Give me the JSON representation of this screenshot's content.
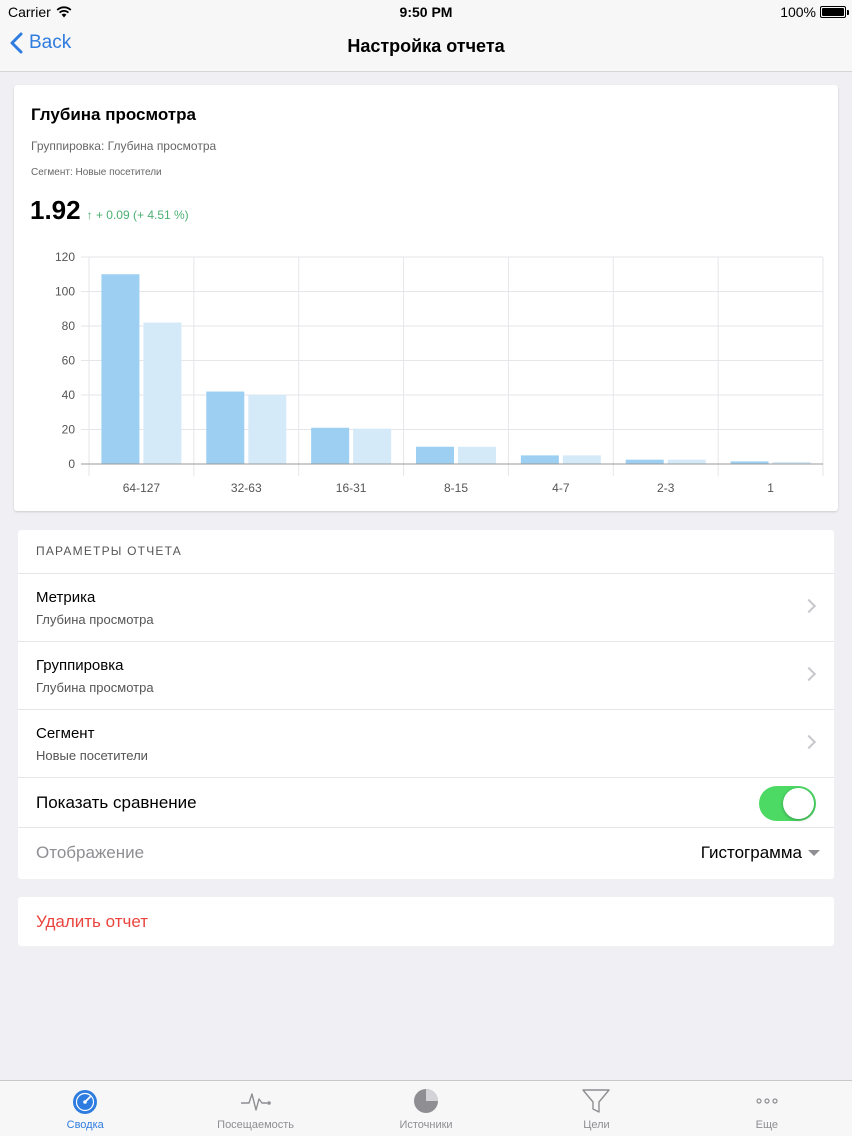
{
  "status_bar": {
    "carrier": "Carrier",
    "time": "9:50 PM",
    "battery": "100%"
  },
  "nav": {
    "back_label": "Back",
    "title": "Настройка отчета"
  },
  "report": {
    "title": "Глубина просмотра",
    "grouping": "Группировка: Глубина просмотра",
    "segment": "Сегмент: Новые посетители",
    "value": "1.92",
    "delta": "↑ + 0.09 (+ 4.51 %)"
  },
  "chart_data": {
    "type": "bar",
    "categories": [
      "64-127",
      "32-63",
      "16-31",
      "8-15",
      "4-7",
      "2-3",
      "1"
    ],
    "series": [
      {
        "values": [
          110,
          42,
          21,
          10,
          5,
          2.5,
          1.5
        ],
        "color": "#9ccff1"
      },
      {
        "values": [
          82,
          40,
          20.5,
          10,
          5,
          2.5,
          1.2
        ],
        "color": "#d5eaf9"
      }
    ],
    "yticks": [
      0,
      20,
      40,
      60,
      80,
      100,
      120
    ],
    "ylim": [
      0,
      120
    ],
    "grid": true
  },
  "params": {
    "header": "ПАРАМЕТРЫ ОТЧЕТА",
    "rows": [
      {
        "title": "Метрика",
        "subtitle": "Глубина просмотра"
      },
      {
        "title": "Группировка",
        "subtitle": "Глубина просмотра"
      },
      {
        "title": "Сегмент",
        "subtitle": "Новые посетители"
      }
    ],
    "compare_label": "Показать сравнение",
    "compare_enabled": true,
    "display_label": "Отображение",
    "display_value": "Гистограмма"
  },
  "delete_label": "Удалить отчет",
  "tabs": [
    {
      "label": "Сводка",
      "icon": "gauge-icon",
      "active": true
    },
    {
      "label": "Посещаемость",
      "icon": "pulse-icon",
      "active": false
    },
    {
      "label": "Источники",
      "icon": "pie-chart-icon",
      "active": false
    },
    {
      "label": "Цели",
      "icon": "funnel-icon",
      "active": false
    },
    {
      "label": "Еще",
      "icon": "more-icon",
      "active": false
    }
  ],
  "colors": {
    "accent": "#2f7ce0",
    "toggle_on": "#4cd964",
    "danger": "#e9453e",
    "positive": "#4caf72"
  }
}
